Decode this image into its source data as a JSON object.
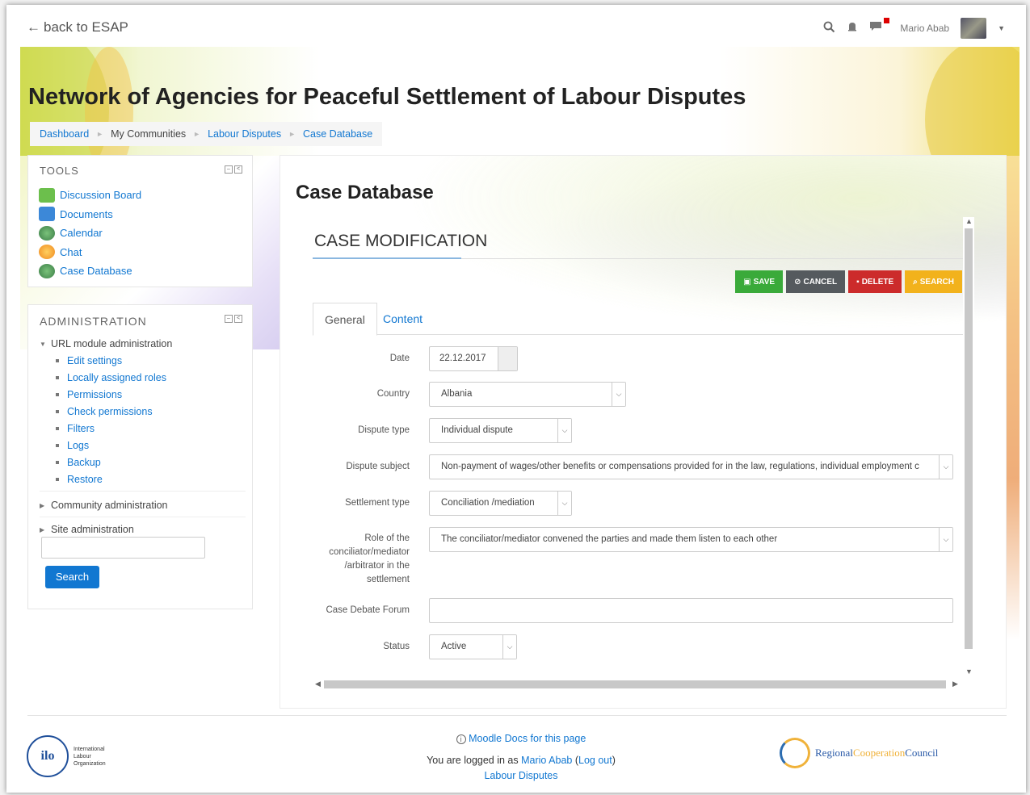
{
  "topbar": {
    "back_label": "back to ESAP",
    "user_name": "Mario Abab"
  },
  "page": {
    "heading": "Network of Agencies for Peaceful Settlement of Labour Disputes"
  },
  "breadcrumb": [
    "Dashboard",
    "My Communities",
    "Labour Disputes",
    "Case Database"
  ],
  "tools": {
    "title": "TOOLS",
    "items": [
      {
        "label": "Discussion Board",
        "icon": "discussion-board-icon",
        "color": "#4fae4a"
      },
      {
        "label": "Documents",
        "icon": "folder-icon",
        "color": "#3c88d8"
      },
      {
        "label": "Calendar",
        "icon": "calendar-icon",
        "color": "#4f9a55"
      },
      {
        "label": "Chat",
        "icon": "chat-icon",
        "color": "#f0a830"
      },
      {
        "label": "Case Database",
        "icon": "database-icon",
        "color": "#4f9a55"
      }
    ]
  },
  "administration": {
    "title": "ADMINISTRATION",
    "url_module": "URL module administration",
    "url_module_items": [
      "Edit settings",
      "Locally assigned roles",
      "Permissions",
      "Check permissions",
      "Filters",
      "Logs",
      "Backup",
      "Restore"
    ],
    "community_admin": "Community administration",
    "site_admin": "Site administration",
    "search_button": "Search"
  },
  "main": {
    "title": "Case Database",
    "section": "CASE MODIFICATION",
    "actions": [
      {
        "label": "SAVE",
        "icon": "save-icon",
        "color": "#3aaa3a"
      },
      {
        "label": "CANCEL",
        "icon": "cancel-icon",
        "color": "#555a5e"
      },
      {
        "label": "DELETE",
        "icon": "delete-icon",
        "color": "#cc2b2b"
      },
      {
        "label": "SEARCH",
        "icon": "search-icon",
        "color": "#f2b21c"
      }
    ],
    "tabs": [
      "General",
      "Content"
    ],
    "form": {
      "date_label": "Date",
      "date_value": "22.12.2017",
      "country_label": "Country",
      "country_value": "Albania",
      "dispute_type_label": "Dispute type",
      "dispute_type_value": "Individual dispute",
      "dispute_subject_label": "Dispute subject",
      "dispute_subject_value": "Non-payment of wages/other benefits or compensations provided for in the law, regulations, individual employment c",
      "settlement_type_label": "Settlement type",
      "settlement_type_value": "Conciliation /mediation",
      "role_label": "Role of the conciliator/mediator /arbitrator in the settlement",
      "role_value": "The conciliator/mediator convened the parties and made them listen to each other",
      "forum_label": "Case Debate Forum",
      "forum_value": "",
      "status_label": "Status",
      "status_value": "Active"
    }
  },
  "footer": {
    "docs_link": "Moodle Docs for this page",
    "logged_prefix": "You are logged in as",
    "user_link": "Mario Abab",
    "logout_link": "Log out",
    "community_link": "Labour Disputes",
    "ilo_text": [
      "International",
      "Labour",
      "Organization"
    ],
    "ilo_mark": "ilo",
    "rcc_parts": [
      "Regional",
      "Cooperation",
      "Council"
    ]
  },
  "colors": {
    "link": "#1177d1",
    "rcc_regional": "#2b5ba8",
    "rcc_cooperation": "#f0b23a",
    "rcc_council": "#2b5ba8"
  }
}
